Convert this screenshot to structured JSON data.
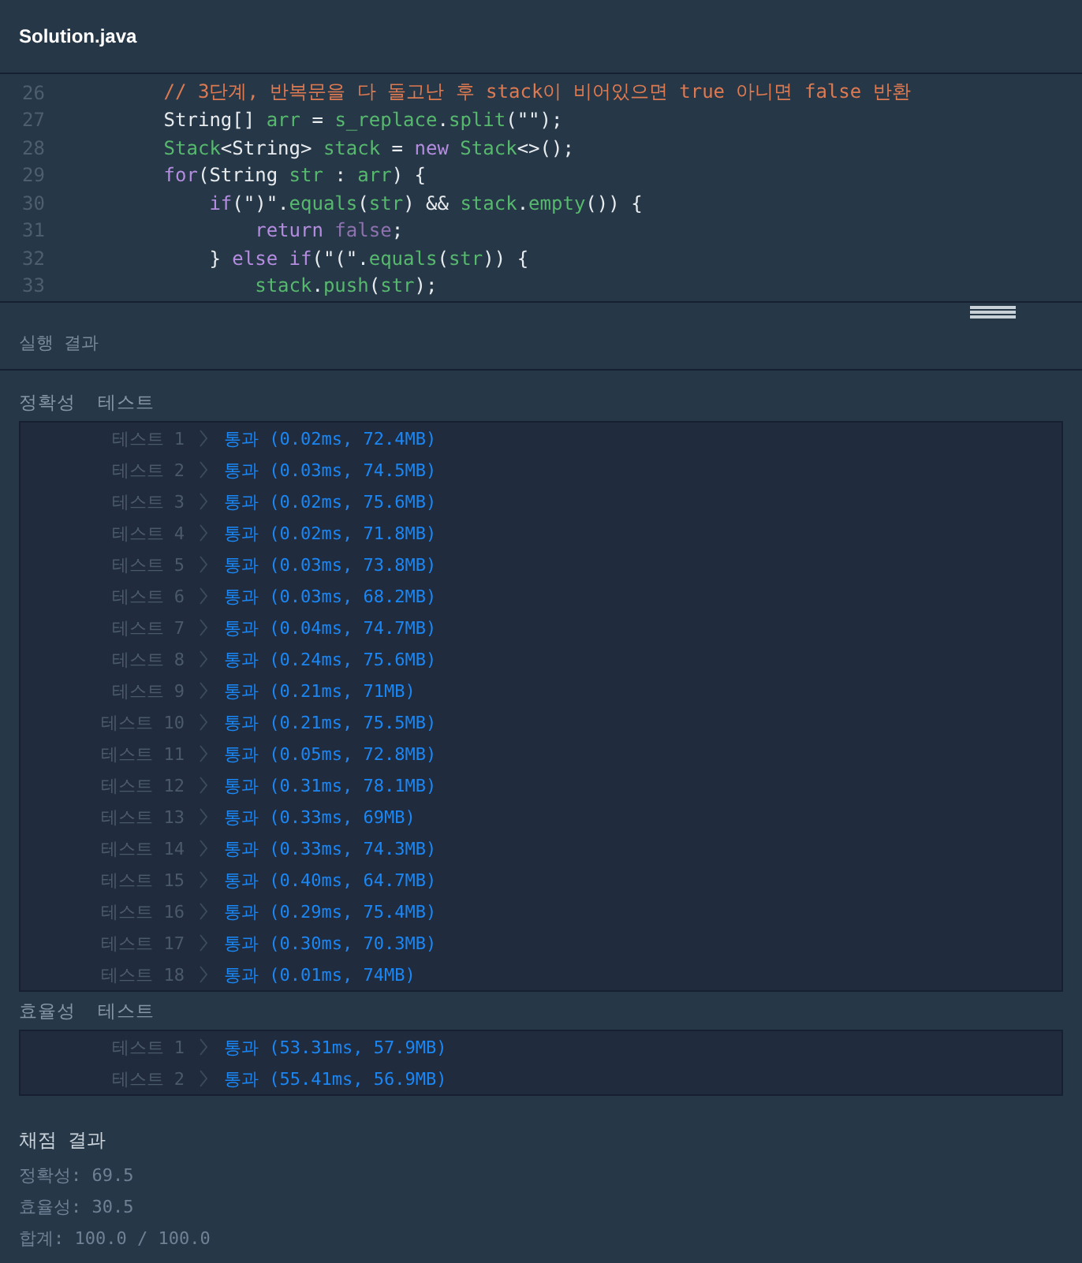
{
  "editor": {
    "filename": "Solution.java",
    "lines": [
      {
        "number": "26",
        "tokens": [
          {
            "kind": "comment",
            "text": "        // 3단계, 반복문을 다 돌고난 후 stack이 비어있으면 true 아니면 false 반환"
          }
        ]
      },
      {
        "number": "27",
        "tokens": [
          {
            "kind": "plain",
            "text": "        String[] "
          },
          {
            "kind": "ident",
            "text": "arr"
          },
          {
            "kind": "plain",
            "text": " = "
          },
          {
            "kind": "ident",
            "text": "s_replace"
          },
          {
            "kind": "plain",
            "text": "."
          },
          {
            "kind": "ident",
            "text": "split"
          },
          {
            "kind": "plain",
            "text": "(\"\");"
          }
        ]
      },
      {
        "number": "28",
        "tokens": [
          {
            "kind": "ident",
            "text": "        Stack"
          },
          {
            "kind": "plain",
            "text": "<String> "
          },
          {
            "kind": "ident",
            "text": "stack"
          },
          {
            "kind": "plain",
            "text": " = "
          },
          {
            "kind": "keyword",
            "text": "new"
          },
          {
            "kind": "ident",
            "text": " Stack"
          },
          {
            "kind": "plain",
            "text": "<>();"
          }
        ]
      },
      {
        "number": "29",
        "tokens": [
          {
            "kind": "keyword",
            "text": "        for"
          },
          {
            "kind": "plain",
            "text": "(String "
          },
          {
            "kind": "ident",
            "text": "str"
          },
          {
            "kind": "plain",
            "text": " : "
          },
          {
            "kind": "ident",
            "text": "arr"
          },
          {
            "kind": "plain",
            "text": ") {"
          }
        ]
      },
      {
        "number": "30",
        "tokens": [
          {
            "kind": "keyword",
            "text": "            if"
          },
          {
            "kind": "plain",
            "text": "(\")\"."
          },
          {
            "kind": "ident",
            "text": "equals"
          },
          {
            "kind": "plain",
            "text": "("
          },
          {
            "kind": "ident",
            "text": "str"
          },
          {
            "kind": "plain",
            "text": ") && "
          },
          {
            "kind": "ident",
            "text": "stack"
          },
          {
            "kind": "plain",
            "text": "."
          },
          {
            "kind": "ident",
            "text": "empty"
          },
          {
            "kind": "plain",
            "text": "()) {"
          }
        ]
      },
      {
        "number": "31",
        "tokens": [
          {
            "kind": "keyword",
            "text": "                return"
          },
          {
            "kind": "literal",
            "text": " false"
          },
          {
            "kind": "plain",
            "text": ";"
          }
        ]
      },
      {
        "number": "32",
        "tokens": [
          {
            "kind": "plain",
            "text": "            } "
          },
          {
            "kind": "keyword",
            "text": "else if"
          },
          {
            "kind": "plain",
            "text": "(\"(\"."
          },
          {
            "kind": "ident",
            "text": "equals"
          },
          {
            "kind": "plain",
            "text": "("
          },
          {
            "kind": "ident",
            "text": "str"
          },
          {
            "kind": "plain",
            "text": ")) {"
          }
        ]
      },
      {
        "number": "33",
        "tokens": [
          {
            "kind": "ident",
            "text": "                stack"
          },
          {
            "kind": "plain",
            "text": "."
          },
          {
            "kind": "ident",
            "text": "push"
          },
          {
            "kind": "plain",
            "text": "("
          },
          {
            "kind": "ident",
            "text": "str"
          },
          {
            "kind": "plain",
            "text": ");"
          }
        ]
      }
    ]
  },
  "results_title": "실행 결과",
  "groups": [
    {
      "title": "정확성  테스트",
      "tests": [
        {
          "label": "테스트 1",
          "result": "통과",
          "detail": "(0.02ms, 72.4MB)"
        },
        {
          "label": "테스트 2",
          "result": "통과",
          "detail": "(0.03ms, 74.5MB)"
        },
        {
          "label": "테스트 3",
          "result": "통과",
          "detail": "(0.02ms, 75.6MB)"
        },
        {
          "label": "테스트 4",
          "result": "통과",
          "detail": "(0.02ms, 71.8MB)"
        },
        {
          "label": "테스트 5",
          "result": "통과",
          "detail": "(0.03ms, 73.8MB)"
        },
        {
          "label": "테스트 6",
          "result": "통과",
          "detail": "(0.03ms, 68.2MB)"
        },
        {
          "label": "테스트 7",
          "result": "통과",
          "detail": "(0.04ms, 74.7MB)"
        },
        {
          "label": "테스트 8",
          "result": "통과",
          "detail": "(0.24ms, 75.6MB)"
        },
        {
          "label": "테스트 9",
          "result": "통과",
          "detail": "(0.21ms, 71MB)"
        },
        {
          "label": "테스트 10",
          "result": "통과",
          "detail": "(0.21ms, 75.5MB)"
        },
        {
          "label": "테스트 11",
          "result": "통과",
          "detail": "(0.05ms, 72.8MB)"
        },
        {
          "label": "테스트 12",
          "result": "통과",
          "detail": "(0.31ms, 78.1MB)"
        },
        {
          "label": "테스트 13",
          "result": "통과",
          "detail": "(0.33ms, 69MB)"
        },
        {
          "label": "테스트 14",
          "result": "통과",
          "detail": "(0.33ms, 74.3MB)"
        },
        {
          "label": "테스트 15",
          "result": "통과",
          "detail": "(0.40ms, 64.7MB)"
        },
        {
          "label": "테스트 16",
          "result": "통과",
          "detail": "(0.29ms, 75.4MB)"
        },
        {
          "label": "테스트 17",
          "result": "통과",
          "detail": "(0.30ms, 70.3MB)"
        },
        {
          "label": "테스트 18",
          "result": "통과",
          "detail": "(0.01ms, 74MB)"
        }
      ]
    },
    {
      "title": "효율성  테스트",
      "tests": [
        {
          "label": "테스트 1",
          "result": "통과",
          "detail": "(53.31ms, 57.9MB)"
        },
        {
          "label": "테스트 2",
          "result": "통과",
          "detail": "(55.41ms, 56.9MB)"
        }
      ]
    }
  ],
  "grading": {
    "title": "채점 결과",
    "lines": [
      "정확성: 69.5",
      "효율성: 30.5",
      "합계: 100.0 / 100.0"
    ]
  }
}
